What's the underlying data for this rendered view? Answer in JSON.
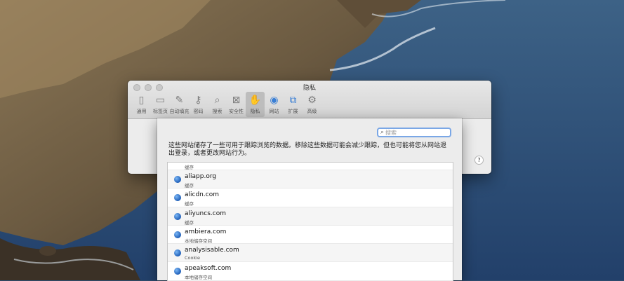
{
  "window": {
    "title": "隐私",
    "toolbar": [
      {
        "label": "通用",
        "icon": "switch-icon"
      },
      {
        "label": "标签页",
        "icon": "tabs-icon"
      },
      {
        "label": "自动填充",
        "icon": "pencil-icon"
      },
      {
        "label": "密码",
        "icon": "key-icon"
      },
      {
        "label": "搜索",
        "icon": "search-icon"
      },
      {
        "label": "安全性",
        "icon": "lock-icon"
      },
      {
        "label": "隐私",
        "icon": "hand-icon"
      },
      {
        "label": "网站",
        "icon": "globe-icon"
      },
      {
        "label": "扩展",
        "icon": "puzzle-icon"
      },
      {
        "label": "高级",
        "icon": "gear-icon"
      }
    ],
    "active_tab": "隐私",
    "help": "?"
  },
  "sheet": {
    "search_placeholder": "搜索",
    "description": "这些网站储存了一些可用于跟踪浏览的数据。移除这些数据可能会减少跟踪，但也可能将您从网站退出登录，或者更改网站行为。",
    "rows": [
      {
        "domain": "",
        "kind": "缓存"
      },
      {
        "domain": "aliapp.org",
        "kind": "缓存"
      },
      {
        "domain": "alicdn.com",
        "kind": "缓存"
      },
      {
        "domain": "aliyuncs.com",
        "kind": "缓存"
      },
      {
        "domain": "ambiera.com",
        "kind": "本地储存空间"
      },
      {
        "domain": "analysisable.com",
        "kind": "Cookie"
      },
      {
        "domain": "apeaksoft.com",
        "kind": "本地储存空间"
      }
    ]
  }
}
